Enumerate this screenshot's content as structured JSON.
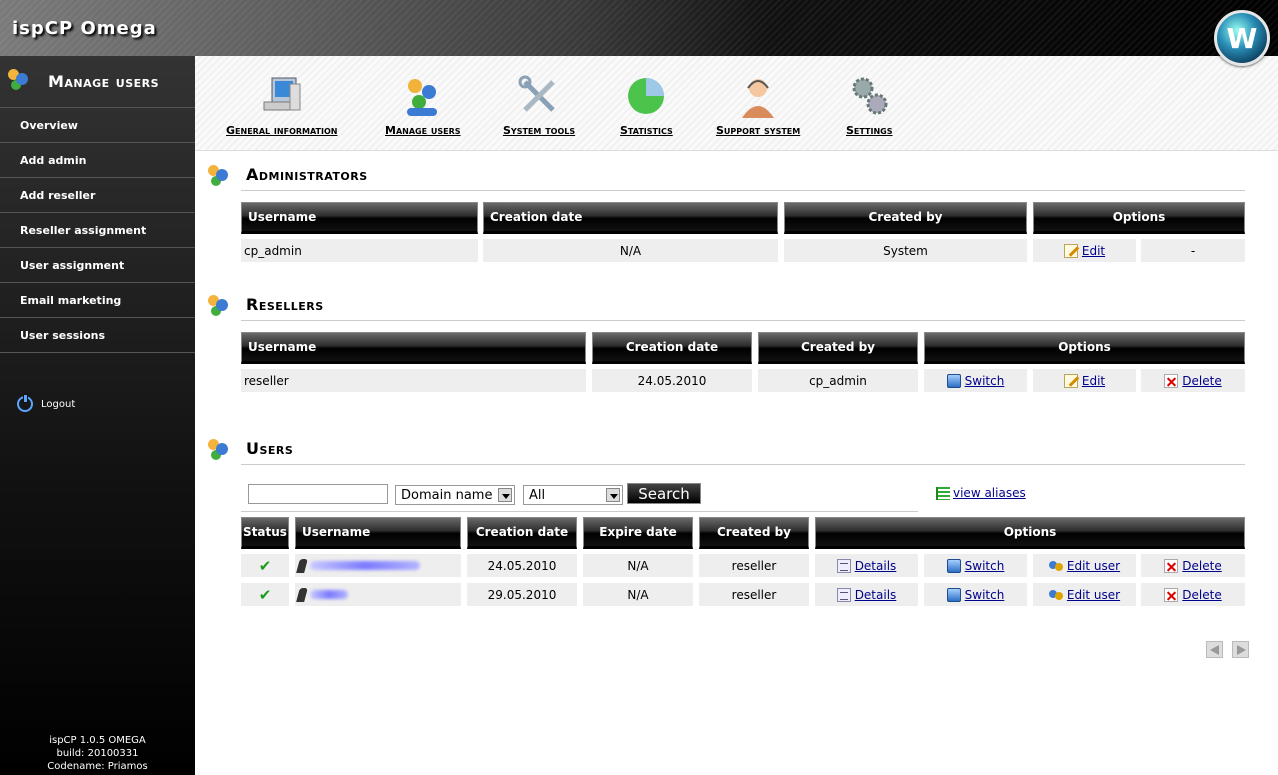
{
  "app": {
    "title": "ispCP Omega",
    "badge_letter": "W"
  },
  "sidebar": {
    "title": "Manage users",
    "items": [
      {
        "label": "Overview"
      },
      {
        "label": "Add admin"
      },
      {
        "label": "Add reseller"
      },
      {
        "label": "Reseller assignment"
      },
      {
        "label": "User assignment"
      },
      {
        "label": "Email marketing"
      },
      {
        "label": "User sessions"
      }
    ],
    "logout": "Logout",
    "footer": {
      "version": "ispCP 1.0.5 OMEGA",
      "build": "build: 20100331",
      "codename": "Codename: Priamos"
    }
  },
  "toolbar": {
    "items": [
      {
        "label": "General information",
        "icon": "monitor-icon"
      },
      {
        "label": "Manage users",
        "icon": "users-icon"
      },
      {
        "label": "System tools",
        "icon": "tools-icon"
      },
      {
        "label": "Statistics",
        "icon": "pie-chart-icon"
      },
      {
        "label": "Support system",
        "icon": "support-agent-icon"
      },
      {
        "label": "Settings",
        "icon": "gears-icon"
      }
    ]
  },
  "administrators": {
    "title": "Administrators",
    "headers": {
      "username": "Username",
      "creation": "Creation date",
      "created_by": "Created by",
      "options": "Options"
    },
    "rows": [
      {
        "username": "cp_admin",
        "creation": "N/A",
        "created_by": "System",
        "edit": "Edit",
        "extra": "-"
      }
    ]
  },
  "resellers": {
    "title": "Resellers",
    "headers": {
      "username": "Username",
      "creation": "Creation date",
      "created_by": "Created by",
      "options": "Options"
    },
    "rows": [
      {
        "username": "reseller",
        "creation": "24.05.2010",
        "created_by": "cp_admin",
        "switch": "Switch",
        "edit": "Edit",
        "delete": "Delete"
      }
    ]
  },
  "users": {
    "title": "Users",
    "search": {
      "value": "",
      "type_selected": "Domain name",
      "status_selected": "All",
      "button": "Search"
    },
    "view_aliases": "view aliases",
    "headers": {
      "status": "Status",
      "username": "Username",
      "creation": "Creation date",
      "expire": "Expire date",
      "created_by": "Created by",
      "options": "Options"
    },
    "rows": [
      {
        "creation": "24.05.2010",
        "expire": "N/A",
        "created_by": "reseller",
        "details": "Details",
        "switch": "Switch",
        "edit": "Edit user",
        "delete": "Delete"
      },
      {
        "creation": "29.05.2010",
        "expire": "N/A",
        "created_by": "reseller",
        "details": "Details",
        "switch": "Switch",
        "edit": "Edit user",
        "delete": "Delete"
      }
    ]
  }
}
